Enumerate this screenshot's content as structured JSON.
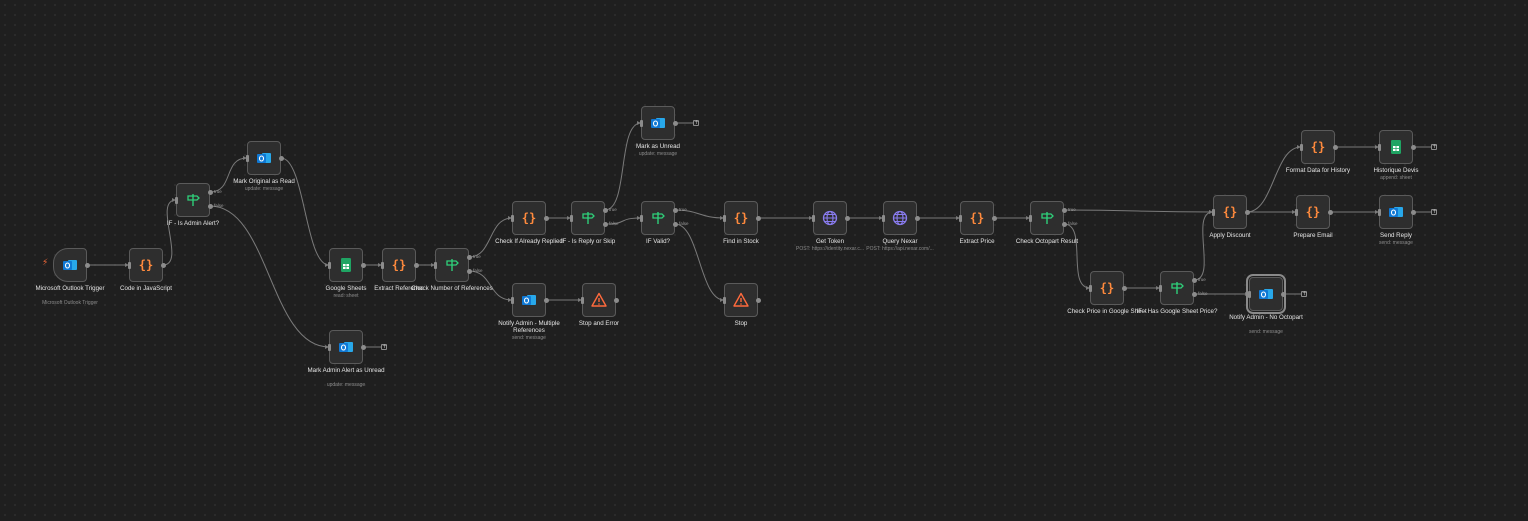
{
  "theme": {
    "background": "#1f1f1f",
    "edge": "#7a7a7a",
    "code": "#ff8a3d",
    "if": "#2fd07a",
    "outlook": "#0f78d4",
    "sheets": "#1fa463",
    "http": "#8a7cf0",
    "error": "#ff6a3d"
  },
  "nodes": [
    {
      "id": "trigger",
      "label": "Microsoft Outlook Trigger",
      "sub": "Microsoft Outlook Trigger",
      "icon": "outlook-icon",
      "trigger": true
    },
    {
      "id": "code_js",
      "label": "Code in JavaScript",
      "sub": "",
      "icon": "code-icon"
    },
    {
      "id": "if_admin",
      "label": "IF - Is Admin Alert?",
      "sub": "",
      "icon": "if-icon",
      "branches": true
    },
    {
      "id": "mark_original",
      "label": "Mark Original as Read",
      "sub": "update: message",
      "icon": "outlook-icon"
    },
    {
      "id": "mark_admin",
      "label": "Mark Admin Alert as Unread",
      "sub": "update: message",
      "icon": "outlook-icon",
      "plus": true
    },
    {
      "id": "gsheets",
      "label": "Google Sheets",
      "sub": "read: sheet",
      "icon": "sheets-icon"
    },
    {
      "id": "extract_ref",
      "label": "Extract Reference",
      "sub": "",
      "icon": "code-icon"
    },
    {
      "id": "check_num",
      "label": "Check Number of References",
      "sub": "",
      "icon": "if-icon",
      "branches": true
    },
    {
      "id": "check_replied",
      "label": "Check If Already Replied",
      "sub": "",
      "icon": "code-icon"
    },
    {
      "id": "notify_multi",
      "label": "Notify Admin - Multiple References",
      "sub": "send: message",
      "icon": "outlook-icon"
    },
    {
      "id": "stop_error",
      "label": "Stop and Error",
      "sub": "",
      "icon": "warning-icon"
    },
    {
      "id": "if_reply",
      "label": "IF - Is Reply or Skip",
      "sub": "",
      "icon": "if-icon",
      "branches": true
    },
    {
      "id": "mark_unread",
      "label": "Mark as Unread",
      "sub": "update: message",
      "icon": "outlook-icon",
      "plus": true
    },
    {
      "id": "if_valid",
      "label": "IF Valid?",
      "sub": "",
      "icon": "if-icon",
      "branches": true
    },
    {
      "id": "find_stock",
      "label": "Find in Stock",
      "sub": "",
      "icon": "code-icon"
    },
    {
      "id": "stop",
      "label": "Stop",
      "sub": "",
      "icon": "warning-icon"
    },
    {
      "id": "get_token",
      "label": "Get Token",
      "sub": "POST: https://identity.nexar.c...",
      "icon": "globe-icon"
    },
    {
      "id": "query_nexar",
      "label": "Query Nexar",
      "sub": "POST: https://api.nexar.com/...",
      "icon": "globe-icon"
    },
    {
      "id": "extract_price",
      "label": "Extract Price",
      "sub": "",
      "icon": "code-icon"
    },
    {
      "id": "check_octo",
      "label": "Check Octopart Result",
      "sub": "",
      "icon": "if-icon",
      "branches": true
    },
    {
      "id": "check_gsheet",
      "label": "Check Price in Google Sheet",
      "sub": "",
      "icon": "code-icon"
    },
    {
      "id": "if_gsheet",
      "label": "IF - Has Google Sheet Price?",
      "sub": "",
      "icon": "if-icon",
      "branches": true
    },
    {
      "id": "notify_octo",
      "label": "Notify Admin - No Octopart",
      "sub": "send: message",
      "icon": "outlook-icon",
      "plus": true,
      "selected": true
    },
    {
      "id": "apply_discount",
      "label": "Apply Discount",
      "sub": "",
      "icon": "code-icon"
    },
    {
      "id": "format_history",
      "label": "Format Data for History",
      "sub": "",
      "icon": "code-icon"
    },
    {
      "id": "historique",
      "label": "Historique Devis",
      "sub": "append: sheet",
      "icon": "sheets-icon",
      "plus": true
    },
    {
      "id": "prepare_email",
      "label": "Prepare Email",
      "sub": "",
      "icon": "code-icon"
    },
    {
      "id": "send_reply",
      "label": "Send Reply",
      "sub": "send: message",
      "icon": "outlook-icon",
      "plus": true
    }
  ],
  "edges": [
    {
      "from": "trigger",
      "to": "code_js"
    },
    {
      "from": "code_js",
      "to": "if_admin"
    },
    {
      "from": "if_admin",
      "port": "true",
      "to": "mark_original"
    },
    {
      "from": "if_admin",
      "port": "false",
      "to": "mark_admin"
    },
    {
      "from": "mark_original",
      "to": "gsheets"
    },
    {
      "from": "gsheets",
      "to": "extract_ref"
    },
    {
      "from": "extract_ref",
      "to": "check_num"
    },
    {
      "from": "check_num",
      "port": "true",
      "to": "check_replied"
    },
    {
      "from": "check_num",
      "port": "false",
      "to": "notify_multi"
    },
    {
      "from": "notify_multi",
      "to": "stop_error"
    },
    {
      "from": "check_replied",
      "to": "if_reply"
    },
    {
      "from": "if_reply",
      "port": "true",
      "to": "mark_unread"
    },
    {
      "from": "if_reply",
      "port": "false",
      "to": "if_valid"
    },
    {
      "from": "if_valid",
      "port": "true",
      "to": "find_stock"
    },
    {
      "from": "if_valid",
      "port": "false",
      "to": "stop"
    },
    {
      "from": "find_stock",
      "to": "get_token"
    },
    {
      "from": "get_token",
      "to": "query_nexar"
    },
    {
      "from": "query_nexar",
      "to": "extract_price"
    },
    {
      "from": "extract_price",
      "to": "check_octo"
    },
    {
      "from": "check_octo",
      "port": "true",
      "to": "apply_discount"
    },
    {
      "from": "check_octo",
      "port": "false",
      "to": "check_gsheet"
    },
    {
      "from": "check_gsheet",
      "to": "if_gsheet"
    },
    {
      "from": "if_gsheet",
      "port": "true",
      "to": "apply_discount"
    },
    {
      "from": "if_gsheet",
      "port": "false",
      "to": "notify_octo"
    },
    {
      "from": "apply_discount",
      "to": "format_history"
    },
    {
      "from": "apply_discount",
      "to": "prepare_email"
    },
    {
      "from": "format_history",
      "to": "historique"
    },
    {
      "from": "prepare_email",
      "to": "send_reply"
    }
  ],
  "branch_labels": {
    "true": "true",
    "false": "false"
  }
}
